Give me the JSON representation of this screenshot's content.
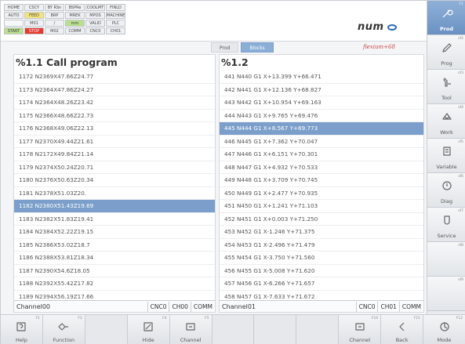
{
  "status": {
    "cells": [
      {
        "label": "HOME",
        "tone": "plain"
      },
      {
        "label": "CSCY",
        "tone": "plain"
      },
      {
        "label": "BY RSn",
        "tone": "plain"
      },
      {
        "label": "BSPRe",
        "tone": "plain"
      },
      {
        "label": "COOLMT",
        "tone": "plain"
      },
      {
        "label": "FINLD",
        "tone": "plain"
      },
      {
        "label": "AUTO",
        "tone": "plain"
      },
      {
        "label": "FEED",
        "tone": "yellow"
      },
      {
        "label": "BRP",
        "tone": "plain"
      },
      {
        "label": "MREK",
        "tone": "plain"
      },
      {
        "label": "MPOS",
        "tone": "plain"
      },
      {
        "label": "MACHINE",
        "tone": "plain"
      },
      {
        "label": "",
        "tone": "blank"
      },
      {
        "label": "M01",
        "tone": "plain"
      },
      {
        "label": "/",
        "tone": "plain"
      },
      {
        "label": "mm",
        "tone": "green"
      },
      {
        "label": "VALID",
        "tone": "plain"
      },
      {
        "label": "PLC",
        "tone": "plain"
      },
      {
        "label": "START",
        "tone": "green"
      },
      {
        "label": "STOP",
        "tone": "red"
      },
      {
        "label": "M02",
        "tone": "plain"
      },
      {
        "label": "COMM",
        "tone": "plain"
      },
      {
        "label": "CNC0",
        "tone": "plain"
      },
      {
        "label": "CH01",
        "tone": "plain"
      }
    ]
  },
  "logo": {
    "text": "num"
  },
  "brand": "flexium+68",
  "mode_tabs": [
    {
      "label": "Prod",
      "active": false
    },
    {
      "label": "Blocks",
      "active": true
    }
  ],
  "left_panel": {
    "title": "%1.1 Call program",
    "selected_index": 10,
    "rows": [
      "1172  N2369X47.66Z24.77",
      "1173  N2364X47.86Z24.27",
      "1174  N2364X48.26Z23.42",
      "1175  N2366X48.66Z22.73",
      "1176  N2368X49.06Z22.13",
      "1177  N2370X49.44Z21.61",
      "1178  N2172X49.84Z21.14",
      "1179  N2374X50.24Z20.71",
      "1180  N2376X50.63Z20.34",
      "1181  N2378X51.03Z20.",
      "1182  N2380X51.43Z19.69",
      "1183  N2382X51.83Z19.41",
      "1184  N2384X52.22Z19.15",
      "1185  N2386X53.02Z18.7",
      "1186  N2388X53.81Z18.34",
      "1187  N2390X54.6Z18.05",
      "1188  N2392X55.42Z17.82",
      "1189  N2394X56.19Z17.66"
    ],
    "footer": {
      "channel": "Channel00",
      "tags": [
        "CNC0",
        "CH00",
        "COMM"
      ]
    }
  },
  "right_panel": {
    "title": "%1.2",
    "selected_index": 4,
    "rows": [
      "441  N440 G1 X+13.399 Y+66.471",
      "442  N441 G1 X+12.136 Y+68.827",
      "443  N442 G1 X+10.954 Y+69.163",
      "444  N443 G1 X+9.765 Y+69.476",
      "445  N444 G1 X+8.567 Y+69.773",
      "446  N445 G1 X+7.362 Y+70.047",
      "447  N446 G1 X+6.151 Y+70.301",
      "448  N447 G1 X+4.932 Y+70.533",
      "449  N448 G1 X+3.709 Y+70.745",
      "450  N449 G1 X+2.477 Y+70.935",
      "451  N450 G1 X+1.241 Y+71.103",
      "452  N451 G1 X+0.003 Y+71.250",
      "453  N452 G1 X-1.246 Y+71.375",
      "454  N453 G1 X-2.496 Y+71.479",
      "455  N454 G1 X-3.750 Y+71.560",
      "456  N455 G1 X-5.008 Y+71.620",
      "457  N456 G1 X-6.266 Y+71.657",
      "458  N457 G1 X-7.633 Y+71.672"
    ],
    "footer": {
      "channel": "Channel01",
      "tags": [
        "CNC0",
        "CH01",
        "COMM"
      ]
    }
  },
  "sidebar": [
    {
      "num": "F1",
      "label": "Prod",
      "icon": "wrench-icon",
      "active": true
    },
    {
      "num": "sf2",
      "label": "Prog",
      "icon": "pencil-icon",
      "active": false
    },
    {
      "num": "sf3",
      "label": "Tool",
      "icon": "tool-icon",
      "active": false
    },
    {
      "num": "sf4",
      "label": "Work",
      "icon": "workpiece-icon",
      "active": false
    },
    {
      "num": "sf5",
      "label": "Variable",
      "icon": "variable-icon",
      "active": false
    },
    {
      "num": "sf6",
      "label": "Diag",
      "icon": "diagnostic-icon",
      "active": false
    },
    {
      "num": "sf7",
      "label": "Service",
      "icon": "service-icon",
      "active": false
    },
    {
      "num": "sf8",
      "label": "",
      "icon": "",
      "active": false
    },
    {
      "num": "sf9",
      "label": "",
      "icon": "",
      "active": false
    }
  ],
  "softkeys": [
    {
      "num": "F1",
      "label": "Help",
      "icon": "help-icon"
    },
    {
      "num": "F2",
      "label": "Function",
      "icon": "function-icon"
    },
    {
      "num": "",
      "label": "",
      "icon": ""
    },
    {
      "num": "F4",
      "label": "Hide",
      "icon": "hide-icon"
    },
    {
      "num": "F5",
      "label": "Channel",
      "icon": "channel-icon"
    },
    {
      "num": "",
      "label": "",
      "icon": ""
    },
    {
      "num": "",
      "label": "",
      "icon": ""
    },
    {
      "num": "",
      "label": "",
      "icon": ""
    },
    {
      "num": "F10",
      "label": "Channel",
      "icon": "channel-icon"
    },
    {
      "num": "F11",
      "label": "Back",
      "icon": "back-icon"
    },
    {
      "num": "F12",
      "label": "Mode",
      "icon": "mode-icon"
    }
  ]
}
